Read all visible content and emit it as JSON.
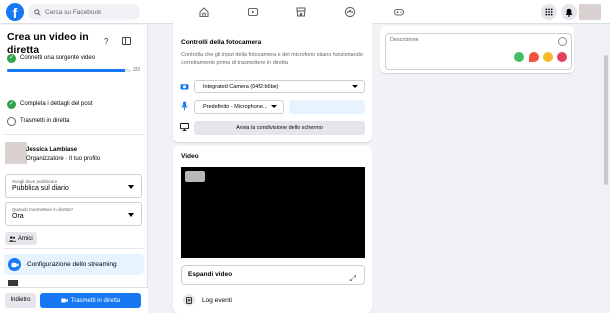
{
  "header": {
    "search_placeholder": "Cerca su Facebook",
    "nav_icons": [
      "home-icon",
      "watch-icon",
      "marketplace-icon",
      "groups-icon",
      "gaming-icon"
    ],
    "right_icons": [
      "menu-grid-icon",
      "notifications-icon",
      "avatar"
    ]
  },
  "sidebar": {
    "title": "Crea un video in diretta",
    "progress_text": "2/3",
    "progress_fraction": 0.95,
    "steps": [
      {
        "label": "Connetti una sorgente video",
        "done": true
      },
      {
        "label": "Completa i dettagli del post",
        "done": true
      },
      {
        "label": "Trasmetti in diretta",
        "done": false
      }
    ],
    "profile": {
      "name": "Jessica Lambiase",
      "role": "Organizzatore · Il tuo profilo"
    },
    "publish": {
      "label": "Scegli dove pubblicare",
      "value": "Pubblica sul diario"
    },
    "when": {
      "label": "Quando trasmettere in diretta?",
      "value": "Ora"
    },
    "audience_label": "Amici",
    "config_label": "Configurazione dello streaming",
    "back_label": "Indietro",
    "go_live_label": "Trasmetti in diretta"
  },
  "camera_card": {
    "title": "Controlli della fotocamera",
    "description": "Controlla che gli input della fotocamera e del microfono stiano funzionando correttamente prima di trasmettere in diretta",
    "camera_value": "Integrated Camera (04f2:b6be)",
    "mic_value": "Predefinito - Microphone...",
    "share_screen_label": "Avvia la condivisione dello schermo"
  },
  "video_card": {
    "title": "Video",
    "expand_label": "Espandi video",
    "log_label": "Log eventi"
  },
  "description_card": {
    "label": "Descrizione",
    "action_icons": [
      "tag-people-icon",
      "location-icon",
      "feeling-icon",
      "donate-icon"
    ]
  },
  "colors": {
    "brand": "#1877f2",
    "success": "#31a24c",
    "page_bg": "#f0f2f5"
  }
}
